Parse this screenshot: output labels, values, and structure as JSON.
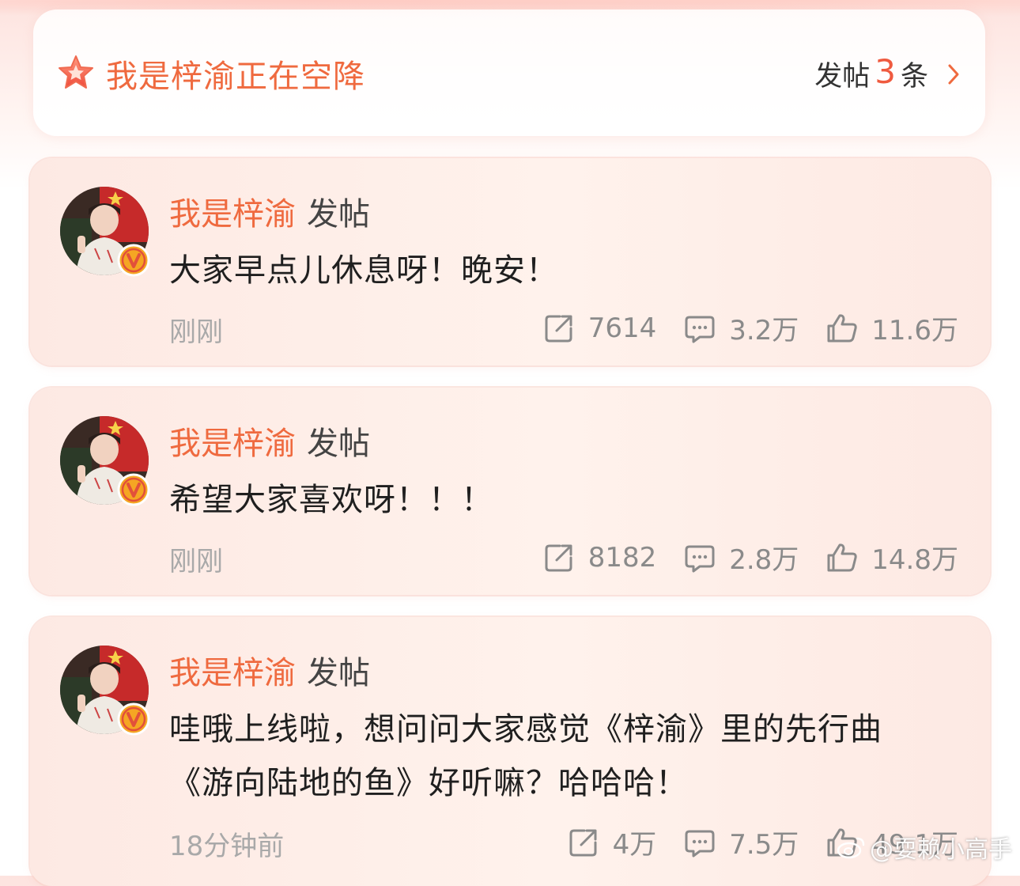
{
  "topic": {
    "title": "我是梓渝正在空降",
    "count_prefix": "发帖",
    "count": "3",
    "count_suffix": "条"
  },
  "posts": [
    {
      "author": "我是梓渝",
      "action": "发帖",
      "content": "大家早点儿休息呀！晚安！",
      "time": "刚刚",
      "reposts": "7614",
      "comments": "3.2万",
      "likes": "11.6万"
    },
    {
      "author": "我是梓渝",
      "action": "发帖",
      "content": "希望大家喜欢呀！！！",
      "time": "刚刚",
      "reposts": "8182",
      "comments": "2.8万",
      "likes": "14.8万"
    },
    {
      "author": "我是梓渝",
      "action": "发帖",
      "content_line1": "哇哦上线啦，想问问大家感觉《梓渝》里的先行曲",
      "content_line2": "《游向陆地的鱼》好听嘛？哈哈哈！",
      "time": "18分钟前",
      "reposts": "4万",
      "comments": "7.5万",
      "likes": "49.1万"
    }
  ],
  "watermark": "@耍赖小高手",
  "colors": {
    "accent": "#ef6a3f",
    "badge": "#f5a623",
    "muted": "#a9a9a9"
  }
}
